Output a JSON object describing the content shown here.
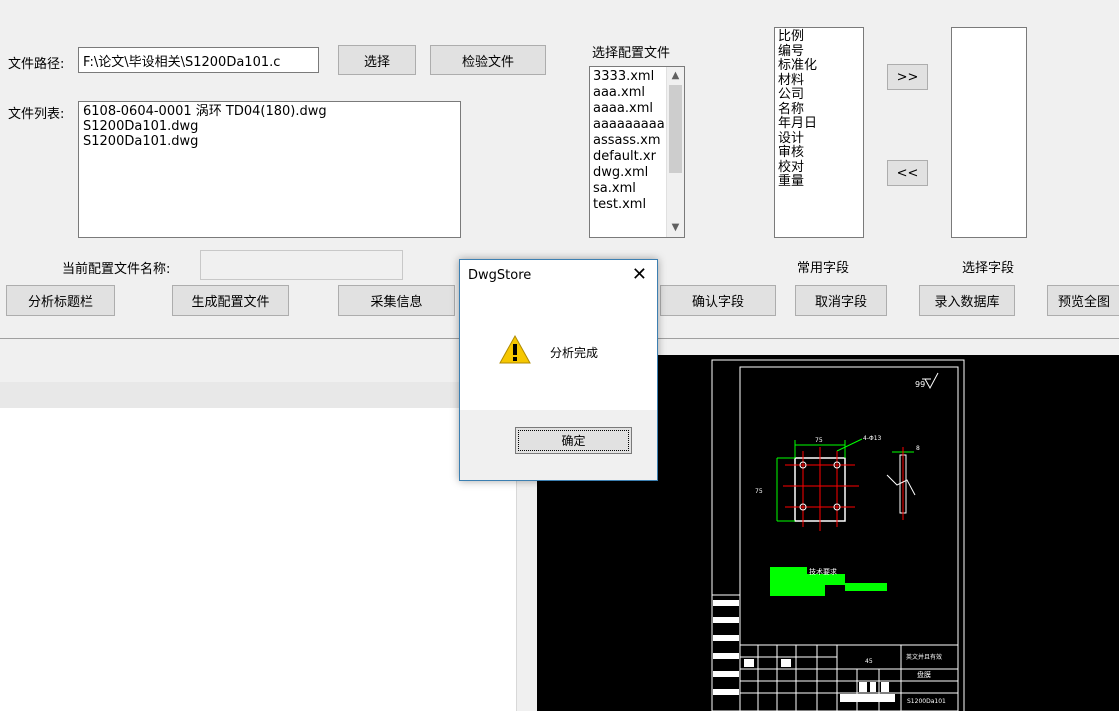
{
  "form": {
    "file_path_label": "文件路径:",
    "file_path_value": "F:\\论文\\毕设相关\\S1200Da101.c",
    "select_button": "选择",
    "check_file_button": "检验文件",
    "file_list_label": "文件列表:",
    "file_list": [
      "6108-0604-0001 涡环 TD04(180).dwg",
      "S1200Da101.dwg",
      "S1200Da101.dwg"
    ],
    "config_list_label": "选择配置文件",
    "config_files": [
      "3333.xml",
      "aaa.xml",
      "aaaa.xml",
      "aaaaaaaaa",
      "assass.xm",
      "default.xr",
      "dwg.xml",
      "sa.xml",
      "test.xml"
    ],
    "common_fields": [
      "比例",
      "编号",
      "标准化",
      "材料",
      "公司",
      "名称",
      "年月日",
      "设计",
      "审核",
      "校对",
      "重量"
    ],
    "add_button": ">>",
    "remove_button": "<<",
    "current_config_label": "当前配置文件名称:",
    "current_config_value": "",
    "common_fields_label": "常用字段",
    "selected_fields_label": "选择字段"
  },
  "toolbar": {
    "analyze_title_block": "分析标题栏",
    "generate_config": "生成配置文件",
    "collect_info": "采集信息",
    "confirm_fields": "确认字段",
    "cancel_fields": "取消字段",
    "enter_database": "录入数据库",
    "preview_full": "预览全图"
  },
  "dialog": {
    "title": "DwgStore",
    "close": "✕",
    "message": "分析完成",
    "ok": "确定",
    "icon": "warning-icon"
  },
  "colors": {
    "window_bg": "#f0f0f0",
    "preview_bg": "#000000",
    "drawing_line": "#ffffff",
    "drawing_accent": "#00ff00",
    "drawing_red": "#ff0000",
    "warning_yellow": "#f6c700"
  }
}
